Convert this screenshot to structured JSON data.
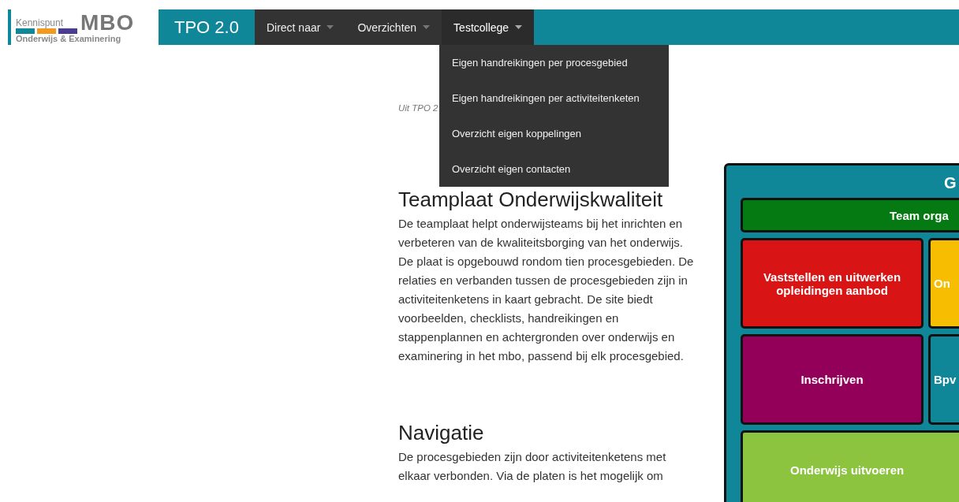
{
  "logo": {
    "name": "Kennispunt",
    "brand": "MBO",
    "subtitle": "Onderwijs & Examinering"
  },
  "app_title": "TPO 2.0",
  "nav": [
    {
      "label": "Direct naar",
      "expanded": false
    },
    {
      "label": "Overzichten",
      "expanded": false
    },
    {
      "label": "Testcollege",
      "expanded": true
    }
  ],
  "dropdown": [
    "Eigen handreikingen per procesgebied",
    "Eigen handreikingen per activiteitenketen",
    "Overzicht eigen koppelingen",
    "Overzicht eigen contacten"
  ],
  "breadcrumb": "Uit TPO 2",
  "sections": [
    {
      "heading": "Teamplaat Onderwijskwaliteit",
      "text": "De teamplaat helpt onderwijsteams bij het inrichten en verbeteren van de kwaliteitsborging van het onderwijs. De plaat is opgebouwd rondom tien procesgebieden. De relaties en verbanden tussen de procesgebieden zijn in activiteitenketens in kaart gebracht. De site biedt voorbeelden, checklists, handreikingen en stappenplannen en achtergronden over onderwijs en examinering in het mbo, passend bij elk procesgebied."
    },
    {
      "heading": "Navigatie",
      "text": "De procesgebieden zijn door activiteitenketens met elkaar verbonden. Via de platen is het mogelijk om"
    }
  ],
  "diagram": {
    "title": "G",
    "rows": [
      {
        "blocks": [
          {
            "label": "Team orga",
            "color": "#067a12"
          }
        ]
      },
      {
        "blocks": [
          {
            "label": "Vaststellen en uitwerken opleidingen aanbod",
            "color": "#d81415"
          },
          {
            "label": "On",
            "color": "#f7bd00"
          }
        ]
      },
      {
        "blocks": [
          {
            "label": "Inschrijven",
            "color": "#93005a"
          },
          {
            "label": "Bpv",
            "color": "#0f8799"
          }
        ]
      },
      {
        "blocks": [
          {
            "label": "Onderwijs uitvoeren",
            "color": "#8cc43f"
          }
        ]
      }
    ]
  }
}
